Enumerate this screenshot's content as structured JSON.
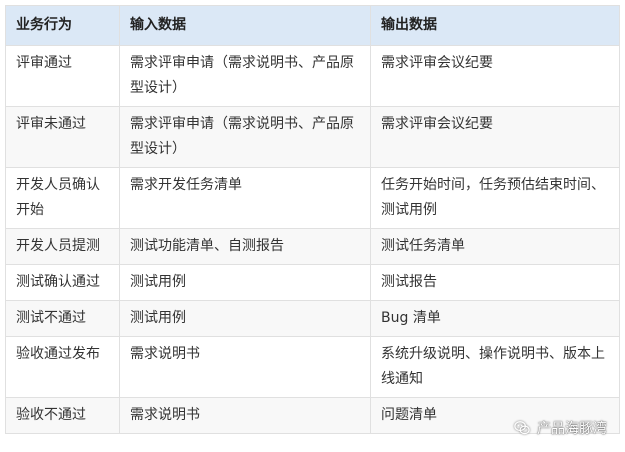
{
  "table": {
    "headers": [
      "业务行为",
      "输入数据",
      "输出数据"
    ],
    "rows": [
      [
        "评审通过",
        "需求评审申请（需求说明书、产品原型设计）",
        "需求评审会议纪要"
      ],
      [
        "评审未通过",
        "需求评审申请（需求说明书、产品原型设计）",
        "需求评审会议纪要"
      ],
      [
        "开发人员确认开始",
        "需求开发任务清单",
        "任务开始时间，任务预估结束时间、测试用例"
      ],
      [
        "开发人员提测",
        "测试功能清单、自测报告",
        "测试任务清单"
      ],
      [
        "测试确认通过",
        "测试用例",
        "测试报告"
      ],
      [
        "测试不通过",
        "测试用例",
        "Bug 清单"
      ],
      [
        "验收通过发布",
        "需求说明书",
        "系统升级说明、操作说明书、版本上线通知"
      ],
      [
        "验收不通过",
        "需求说明书",
        "问题清单"
      ]
    ]
  },
  "watermark": {
    "text": "产品海豚湾",
    "icon": "wechat-icon"
  },
  "colors": {
    "header_bg": "#dbe8f6",
    "border": "#e0e0e0",
    "stripe": "#f8f8f8",
    "text": "#333333"
  }
}
